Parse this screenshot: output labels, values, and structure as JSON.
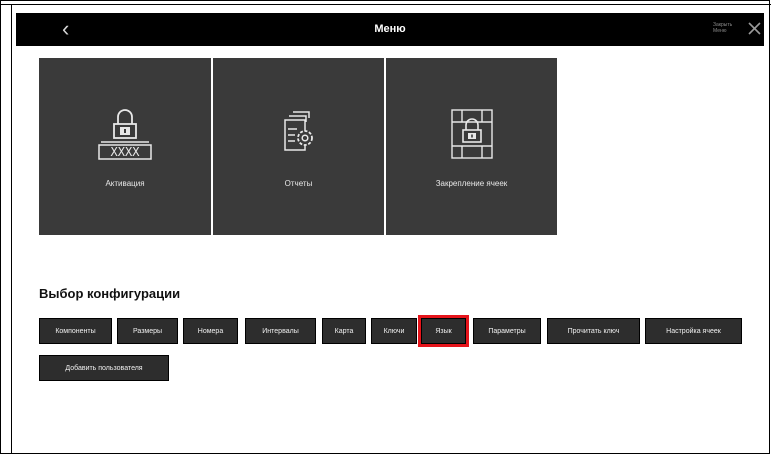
{
  "header": {
    "back_icon": "chevron-left-icon",
    "title": "Меню",
    "close_label": "Закрыть Меню",
    "close_icon": "close-icon"
  },
  "tiles": [
    {
      "label": "Активация",
      "icon": "lock-keypad-icon"
    },
    {
      "label": "Отчеты",
      "icon": "report-gear-icon"
    },
    {
      "label": "Закрепление ячеек",
      "icon": "locked-cells-icon"
    }
  ],
  "config": {
    "title": "Выбор конфигурации",
    "buttons": [
      {
        "label": "Компоненты"
      },
      {
        "label": "Размеры"
      },
      {
        "label": "Номера"
      },
      {
        "label": "Интервалы"
      },
      {
        "label": "Карта"
      },
      {
        "label": "Ключи"
      },
      {
        "label": "Язык",
        "selected": true
      },
      {
        "label": "Параметры"
      },
      {
        "label": "Прочитать ключ"
      },
      {
        "label": "Настройка ячеек"
      },
      {
        "label": "Добавить пользователя"
      }
    ]
  },
  "colors": {
    "tile_bg": "#3a3a3a",
    "button_bg": "#2d2d2d",
    "highlight": "#e5141b",
    "header_bg": "#000000"
  }
}
